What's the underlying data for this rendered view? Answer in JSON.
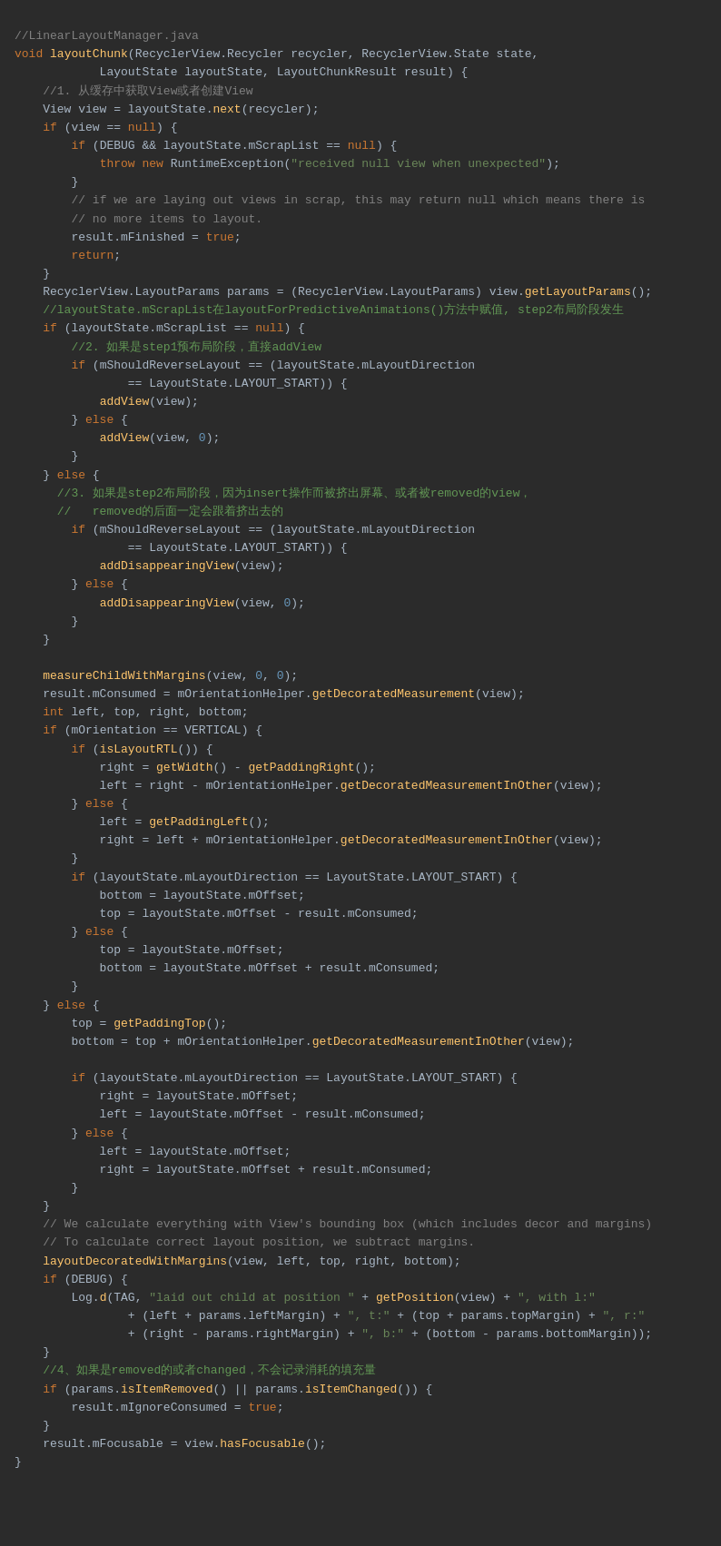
{
  "file_comment": "//LinearLayoutManager.java",
  "code_lines": []
}
